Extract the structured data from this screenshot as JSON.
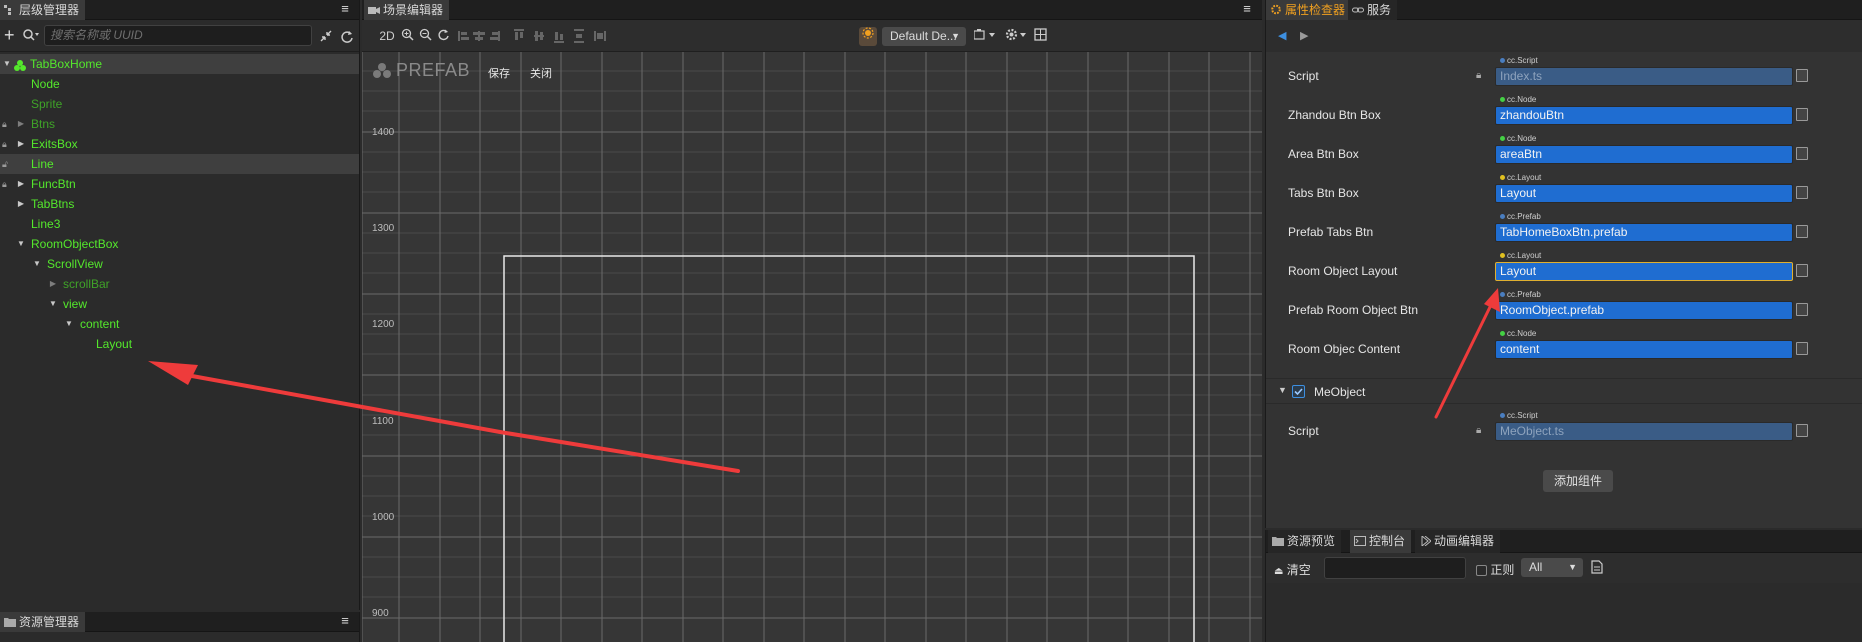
{
  "hierarchy": {
    "tab_title": "层级管理器",
    "add_label": "+",
    "search_placeholder": "搜索名称或 UUID",
    "nodes": [
      {
        "label": "TabBoxHome"
      },
      {
        "label": "Node"
      },
      {
        "label": "Sprite"
      },
      {
        "label": "Btns"
      },
      {
        "label": "ExitsBox"
      },
      {
        "label": "Line"
      },
      {
        "label": "FuncBtn"
      },
      {
        "label": "TabBtns"
      },
      {
        "label": "Line3"
      },
      {
        "label": "RoomObjectBox"
      },
      {
        "label": "ScrollView"
      },
      {
        "label": "scrollBar"
      },
      {
        "label": "view"
      },
      {
        "label": "content"
      },
      {
        "label": "Layout"
      }
    ]
  },
  "assets": {
    "tab_title": "资源管理器"
  },
  "scene": {
    "tab_title": "场景编辑器",
    "mode_label": "2D",
    "design_dropdown": "Default De...",
    "prefab_mark": "PREFAB",
    "save_label": "保存",
    "close_label": "关闭",
    "ruler": [
      "1400",
      "1300",
      "1200",
      "1100",
      "1000",
      "900"
    ]
  },
  "inspector": {
    "tabs": [
      "属性检查器",
      "服务"
    ],
    "props": [
      {
        "label": "Script",
        "type": "cc.Script",
        "value": "Index.ts"
      },
      {
        "label": "Zhandou Btn Box",
        "type": "cc.Node",
        "value": "zhandouBtn"
      },
      {
        "label": "Area Btn Box",
        "type": "cc.Node",
        "value": "areaBtn"
      },
      {
        "label": "Tabs Btn Box",
        "type": "cc.Layout",
        "value": "Layout"
      },
      {
        "label": "Prefab Tabs Btn",
        "type": "cc.Prefab",
        "value": "TabHomeBoxBtn.prefab"
      },
      {
        "label": "Room Object Layout",
        "type": "cc.Layout",
        "value": "Layout"
      },
      {
        "label": "Prefab Room Object Btn",
        "type": "cc.Prefab",
        "value": "RoomObject.prefab"
      },
      {
        "label": "Room Objec Content",
        "type": "cc.Node",
        "value": "content"
      }
    ],
    "component_name": "MeObject",
    "me_script": {
      "label": "Script",
      "type": "cc.Script",
      "value": "MeObject.ts"
    },
    "add_component_label": "添加组件"
  },
  "console": {
    "tabs": [
      "资源预览",
      "控制台",
      "动画编辑器"
    ],
    "clear_label": "清空",
    "regex_label": "正则",
    "level_value": "All"
  },
  "colors": {
    "node_green": "#54e82c",
    "field_blue": "#1f6dd1",
    "accent_orange": "#f0a020",
    "annotation_red": "#ee3b3b"
  }
}
